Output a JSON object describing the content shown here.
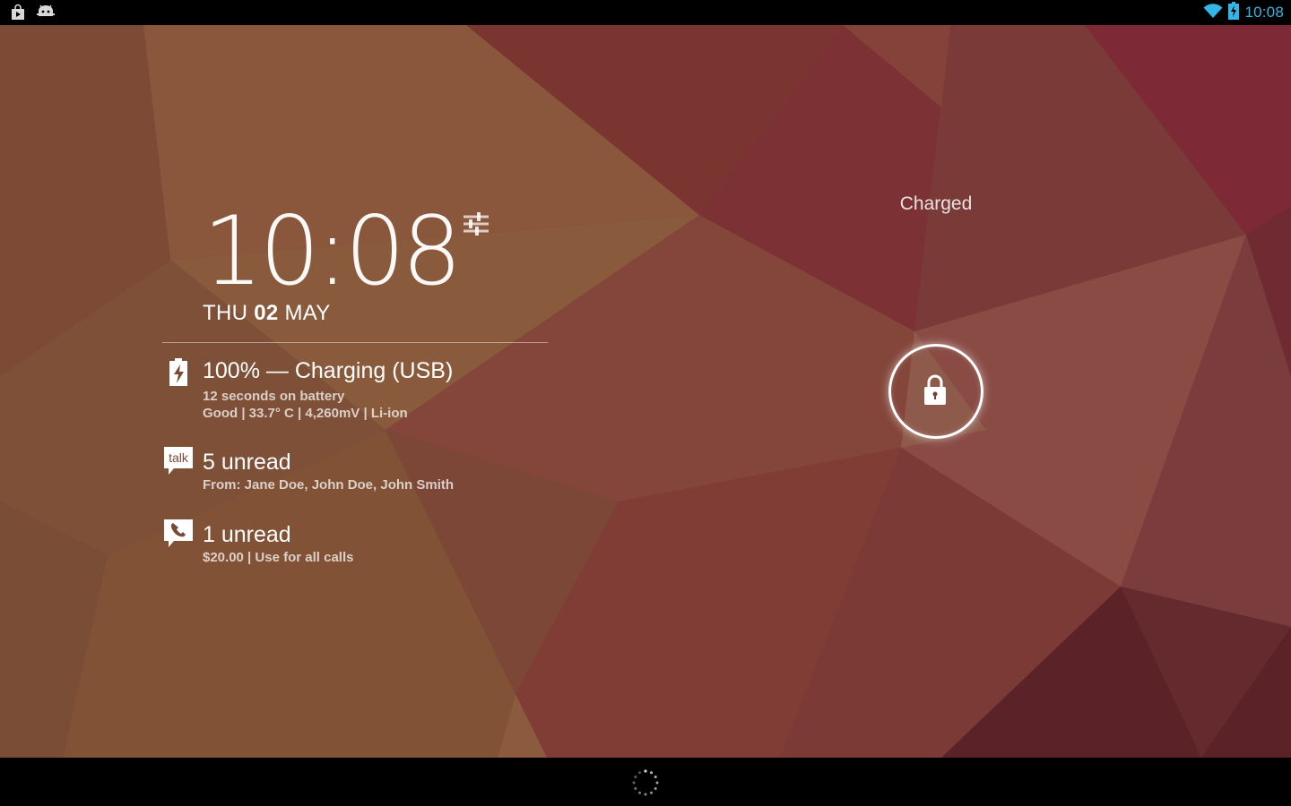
{
  "status_bar": {
    "time": "10:08",
    "left_icons": [
      "shop-bag-icon",
      "android-debug-icon"
    ],
    "right_icons": [
      "wifi-icon",
      "battery-charging-icon"
    ],
    "accent_color": "#33b5e5"
  },
  "clock": {
    "time": "10:08",
    "day": "THU",
    "date_number": "02",
    "month": "MAY"
  },
  "notifications": [
    {
      "icon": "battery-charging-icon",
      "title": "100% — Charging (USB)",
      "lines": [
        "12 seconds on battery",
        "Good | 33.7° C | 4,260mV | Li-ion"
      ]
    },
    {
      "icon": "talk-icon",
      "icon_text": "talk",
      "title": "5 unread",
      "lines": [
        "From: Jane Doe, John Doe, John Smith"
      ]
    },
    {
      "icon": "phone-icon",
      "title": "1 unread",
      "lines": [
        "$20.00 | Use for all calls"
      ]
    }
  ],
  "lock": {
    "status_label": "Charged",
    "icon": "padlock-icon"
  },
  "nav_bar": {
    "icon": "loading-spinner-icon"
  }
}
